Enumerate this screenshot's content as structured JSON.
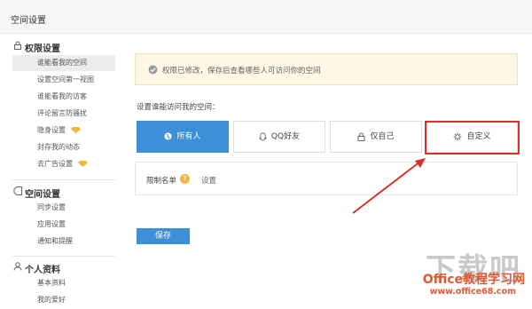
{
  "window": {
    "title": "空间设置"
  },
  "sidebar": {
    "sections": [
      {
        "title": "权限设置",
        "icon": "lock-icon",
        "items": [
          {
            "label": "谁能看我的空间",
            "active": true,
            "vip": false
          },
          {
            "label": "设置空间第一视图",
            "active": false,
            "vip": false
          },
          {
            "label": "谁能看我的访客",
            "active": false,
            "vip": false
          },
          {
            "label": "评论留言防骚扰",
            "active": false,
            "vip": false
          },
          {
            "label": "隐身设置",
            "active": false,
            "vip": true
          },
          {
            "label": "封存我的动态",
            "active": false,
            "vip": false
          },
          {
            "label": "去广告设置",
            "active": false,
            "vip": true
          }
        ]
      },
      {
        "title": "空间设置",
        "icon": "tag-icon",
        "items": [
          {
            "label": "同步设置"
          },
          {
            "label": "应用设置"
          },
          {
            "label": "通知和提醒"
          }
        ]
      },
      {
        "title": "个人资料",
        "icon": "user-icon",
        "items": [
          {
            "label": "基本资料"
          },
          {
            "label": "我的爱好"
          }
        ]
      }
    ]
  },
  "notice": {
    "text": "权限已修改，保存后查看哪些人可访问你的空间",
    "icon": "info-circle-icon"
  },
  "access": {
    "prompt": "设置谁能访问我的空间：",
    "options": [
      {
        "label": "所有人",
        "icon": "globe-icon",
        "selected": true
      },
      {
        "label": "QQ好友",
        "icon": "qq-penguin-icon",
        "selected": false
      },
      {
        "label": "仅自己",
        "icon": "lock-icon",
        "selected": false
      },
      {
        "label": "自定义",
        "icon": "gear-icon",
        "selected": false
      }
    ]
  },
  "restrict": {
    "label": "限制名单",
    "help_icon": "question-icon",
    "help_glyph": "?",
    "action": "设置"
  },
  "save_label": "保存",
  "colors": {
    "accent": "#3d8fd8",
    "highlight": "#d9302a",
    "vip": "#f3b53b",
    "notice_bg": "#fdf7e4"
  },
  "watermark": {
    "big": "下载吧",
    "brand": "Office教程学习网",
    "url": "www.office68.com"
  }
}
